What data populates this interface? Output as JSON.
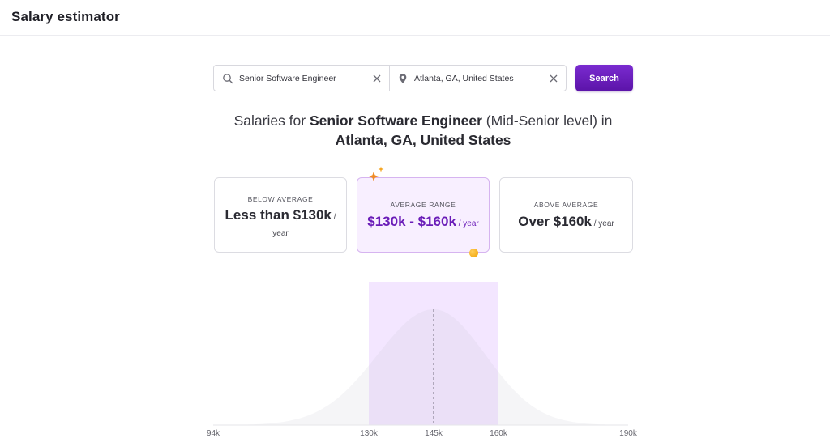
{
  "app": {
    "title": "Salary estimator"
  },
  "search": {
    "job_value": "Senior Software Engineer",
    "location_value": "Atlanta, GA, United States",
    "button_label": "Search"
  },
  "headline": {
    "prefix": "Salaries for ",
    "job": "Senior Software Engineer",
    "level": " (Mid-Senior level) in ",
    "location": "Atlanta, GA, United States"
  },
  "cards": {
    "below": {
      "label": "BELOW AVERAGE",
      "amount": "Less than $130k",
      "unit": " / year"
    },
    "average": {
      "label": "AVERAGE RANGE",
      "amount": "$130k - $160k",
      "unit": " / year"
    },
    "above": {
      "label": "ABOVE AVERAGE",
      "amount": "Over $160k",
      "unit": " / year"
    }
  },
  "colors": {
    "accent": "#6a1cb8",
    "button": "#5b13a8",
    "highlight": "#f8efff",
    "marker": "#f0a000"
  },
  "chart_data": {
    "type": "area",
    "x_ticks": [
      "94k",
      "130k",
      "145k",
      "160k",
      "190k"
    ],
    "x_values": [
      94,
      130,
      145,
      160,
      190
    ],
    "highlight_range": [
      130,
      160
    ],
    "median": 145,
    "grid": false,
    "xlim": [
      94,
      190
    ]
  }
}
